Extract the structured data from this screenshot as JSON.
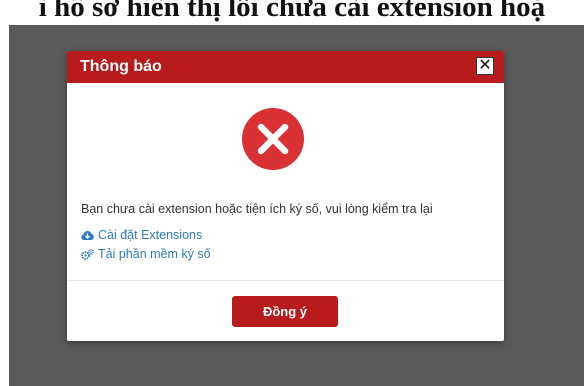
{
  "caption": {
    "text": "ì hồ sơ hiển thị lỗi chưa cài extension hoặ"
  },
  "dialog": {
    "title": "Thông báo",
    "close_label": "✕",
    "error_icon": "error-x-circle-icon",
    "message": "Bạn chưa cài extension hoặc tiện ích ký số, vui lòng kiểm tra lại",
    "links": [
      {
        "label": "Cài đặt Extensions",
        "icon": "cloud-download-icon"
      },
      {
        "label": "Tải phần mềm ký số",
        "icon": "gears-icon"
      }
    ],
    "ok_label": "Đồng ý"
  },
  "colors": {
    "header": "#b71b1c",
    "error_icon": "#d93034",
    "link": "#2f7bc0",
    "overlay": "#5a5a5a",
    "button": "#b71b1c"
  }
}
